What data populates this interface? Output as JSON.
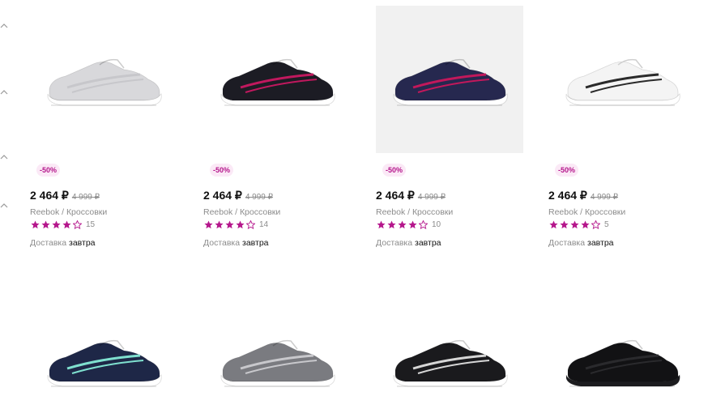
{
  "accent": "#b5178c",
  "products": [
    {
      "discount": "-50%",
      "price": "2 464 ₽",
      "old_price": "4 999 ₽",
      "brand": "Reebok / Кроссовки",
      "rating": 4,
      "reviews": "15",
      "delivery_label": "Доставка",
      "delivery_day": "завтра",
      "colors": {
        "upper": "#d8d8db",
        "accent": "#c7c7cb",
        "sole": "#ffffff"
      }
    },
    {
      "discount": "-50%",
      "price": "2 464 ₽",
      "old_price": "4 999 ₽",
      "brand": "Reebok / Кроссовки",
      "rating": 4,
      "reviews": "14",
      "delivery_label": "Доставка",
      "delivery_day": "завтра",
      "colors": {
        "upper": "#1c1c24",
        "accent": "#c1185e",
        "sole": "#ffffff"
      }
    },
    {
      "discount": "-50%",
      "price": "2 464 ₽",
      "old_price": "4 999 ₽",
      "brand": "Reebok / Кроссовки",
      "rating": 4,
      "reviews": "10",
      "delivery_label": "Доставка",
      "delivery_day": "завтра",
      "colors": {
        "upper": "#26284f",
        "accent": "#c2185b",
        "sole": "#ffffff"
      }
    },
    {
      "discount": "-50%",
      "price": "2 464 ₽",
      "old_price": "4 999 ₽",
      "brand": "Reebok / Кроссовки",
      "rating": 4,
      "reviews": "5",
      "delivery_label": "Доставка",
      "delivery_day": "завтра",
      "colors": {
        "upper": "#f4f4f4",
        "accent": "#2a2a2a",
        "sole": "#ffffff"
      }
    }
  ],
  "products_row2": [
    {
      "colors": {
        "upper": "#1e2747",
        "accent": "#7fe0cf",
        "sole": "#ffffff"
      }
    },
    {
      "colors": {
        "upper": "#7a7b80",
        "accent": "#c8c8cc",
        "sole": "#ffffff"
      }
    },
    {
      "colors": {
        "upper": "#1a1a1d",
        "accent": "#d6d6d6",
        "sole": "#ffffff"
      }
    },
    {
      "colors": {
        "upper": "#121214",
        "accent": "#2a2a2d",
        "sole": "#1c1c1f"
      }
    }
  ]
}
